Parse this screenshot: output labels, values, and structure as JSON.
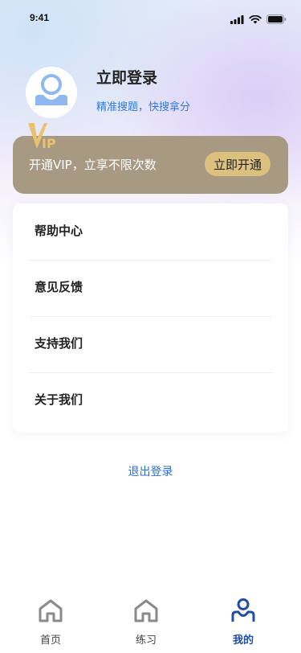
{
  "status_bar": {
    "time": "9:41",
    "icons": [
      "signal-icon",
      "wifi-icon",
      "battery-icon"
    ]
  },
  "profile": {
    "title": "立即登录",
    "subtitle": "精准搜题，快搜拿分",
    "avatar_icon": "user-icon"
  },
  "vip": {
    "logo_text": "IP",
    "text": "开通VIP，立享不限次数",
    "button_label": "立即开通"
  },
  "menu": {
    "items": [
      {
        "label": "帮助中心"
      },
      {
        "label": "意见反馈"
      },
      {
        "label": "支持我们"
      },
      {
        "label": "关于我们"
      }
    ]
  },
  "logout_label": "退出登录",
  "tabbar": {
    "tabs": [
      {
        "label": "首页",
        "icon": "home-icon",
        "active": false
      },
      {
        "label": "练习",
        "icon": "practice-icon",
        "active": false
      },
      {
        "label": "我的",
        "icon": "profile-icon",
        "active": true
      }
    ]
  },
  "colors": {
    "accent_blue": "#2f7be0",
    "vip_card": "#a89a82",
    "vip_button": "#dcc07e",
    "tab_active": "#1f4fa3"
  }
}
